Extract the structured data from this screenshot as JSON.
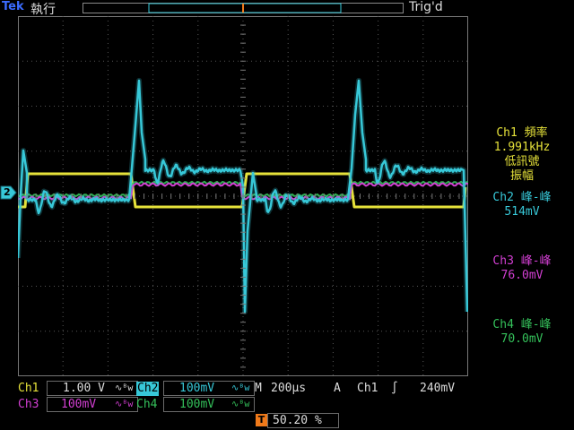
{
  "header": {
    "brand": "Tek",
    "acquisition_mode": "執行",
    "trigger_status": "Trig'd"
  },
  "markers": {
    "trigger_top": "T",
    "trigger_pos": "T",
    "ch2_ground": "2"
  },
  "measurements": [
    {
      "title": "Ch1 頻率",
      "value": "1.991kHz",
      "note1": "低訊號",
      "note2": "振幅",
      "color": "#e6e23a"
    },
    {
      "title": "Ch2 峰-峰",
      "value": "514mV",
      "color": "#37c8d8"
    },
    {
      "title": "Ch3 峰-峰",
      "value": "76.0mV",
      "color": "#d23fd2"
    },
    {
      "title": "Ch4 峰-峰",
      "value": "70.0mV",
      "color": "#34c05a"
    }
  ],
  "channels": [
    {
      "name": "Ch1",
      "scale": "1.00 V",
      "color": "#e6e23a"
    },
    {
      "name": "Ch2",
      "scale": "100mV",
      "color": "#37c8d8"
    },
    {
      "name": "Ch3",
      "scale": "100mV",
      "color": "#d23fd2"
    },
    {
      "name": "Ch4",
      "scale": "100mV",
      "color": "#34c05a"
    }
  ],
  "bw_symbol": "∿ᴮw",
  "timebase": {
    "label": "M",
    "value": "200µs"
  },
  "trigger": {
    "label": "A",
    "source": "Ch1",
    "slope": "∫",
    "level": "240mV"
  },
  "trigger_position": "50.20 %",
  "colors": {
    "ch1": "#e6e23a",
    "ch2": "#37c8d8",
    "ch3": "#d23fd2",
    "ch4": "#34c05a",
    "trigger_marker": "#f07a1a",
    "brand": "#3b6cff"
  }
}
